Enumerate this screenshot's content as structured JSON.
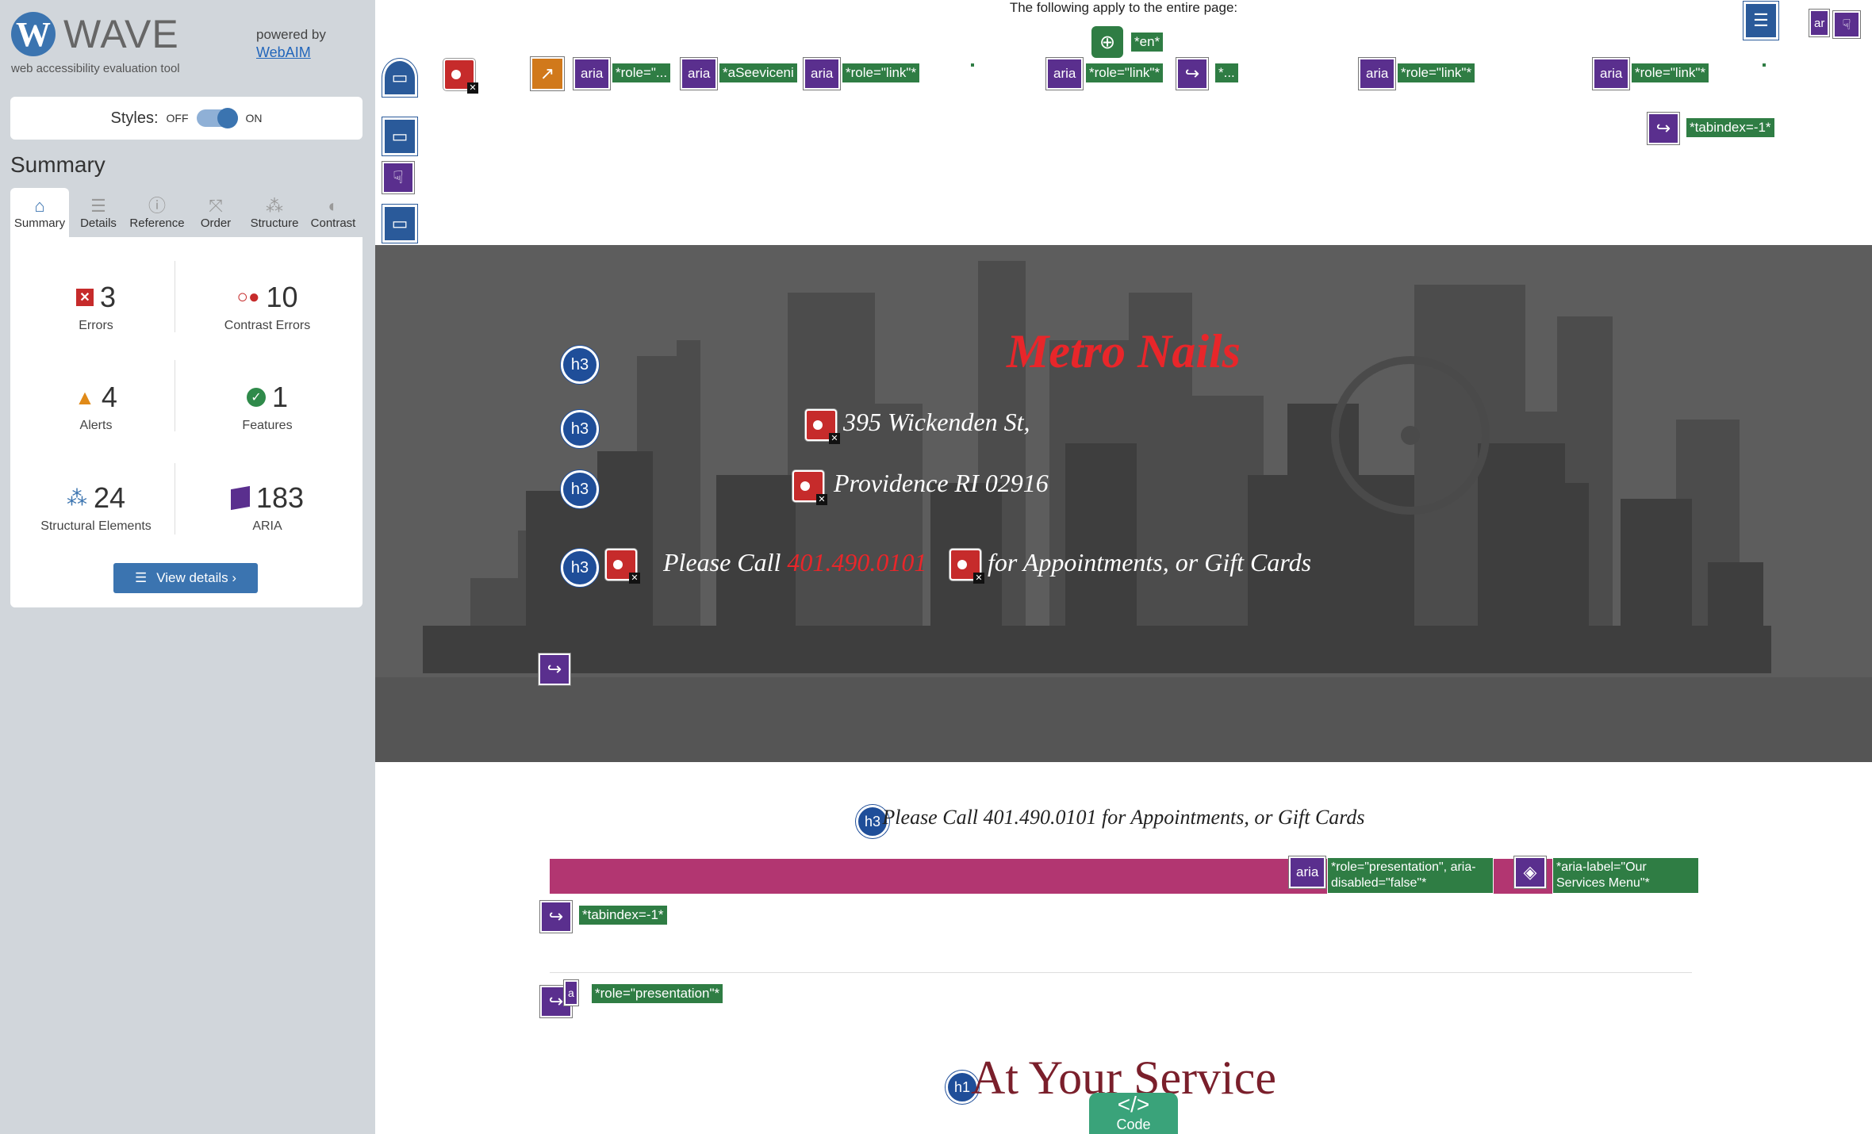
{
  "sidebar": {
    "logo_letter": "W",
    "logo_word": "WAVE",
    "logo_subtitle": "web accessibility evaluation tool",
    "powered_by": "powered by",
    "webaim": "WebAIM",
    "styles_label": "Styles:",
    "styles_off": "OFF",
    "styles_on": "ON",
    "summary_title": "Summary",
    "tabs": [
      {
        "label": "Summary",
        "icon": "home-icon"
      },
      {
        "label": "Details",
        "icon": "list-icon"
      },
      {
        "label": "Reference",
        "icon": "info-icon"
      },
      {
        "label": "Order",
        "icon": "order-icon"
      },
      {
        "label": "Structure",
        "icon": "structure-icon"
      },
      {
        "label": "Contrast",
        "icon": "contrast-icon"
      }
    ],
    "stats": {
      "errors": {
        "count": "3",
        "label": "Errors"
      },
      "contrast_errors": {
        "count": "10",
        "label": "Contrast Errors"
      },
      "alerts": {
        "count": "4",
        "label": "Alerts"
      },
      "features": {
        "count": "1",
        "label": "Features"
      },
      "structural": {
        "count": "24",
        "label": "Structural Elements"
      },
      "aria": {
        "count": "183",
        "label": "ARIA"
      }
    },
    "view_details": "View details ›"
  },
  "page": {
    "apply_text": "The following apply to the entire page:",
    "lang_tag": "*en*",
    "top_tags": {
      "role1": "*role=\"...",
      "aria_label_services": "*aSeeviceni",
      "role_link_1": "*role=\"link\"*",
      "role_link_2": "*role=\"link\"*",
      "ellipsis": "*...",
      "role_link_3": "*role=\"link\"*",
      "role_link_4": "*role=\"link\"*",
      "tabindex_top": "*tabindex=-1*"
    },
    "aria_label": "aria",
    "aria_short": "ar",
    "hero": {
      "title": "Metro Nails",
      "address1": "395 Wickenden St,",
      "address2": "Providence RI 02916",
      "call_prefix": "Please Call",
      "phone": "401.490.0101",
      "call_suffix": "for Appointments, or Gift Cards"
    },
    "h3": "h3",
    "h1": "h1",
    "call_line": "Please Call 401.490.0101 for Appointments, or Gift Cards",
    "bar_tags": {
      "presentation": "*role=\"presentation\", aria-disabled=\"false\"*",
      "aria_label_menu": "*aria-label=\"Our Services Menu\"*"
    },
    "tabindex_1": "*tabindex=-1*",
    "presentation_tag": "*role=\"presentation\"*",
    "service_title": "At Your Service",
    "code_label": "Code",
    "code_symbol": "</>"
  },
  "colors": {
    "error": "#c62b2b",
    "aria_purple": "#5a2f8e",
    "tag_green": "#2f7d44",
    "heading_blue": "#1f4e99",
    "brand_red": "#e8262a",
    "bar_magenta": "#b23671",
    "service_maroon": "#7a1f2b"
  }
}
